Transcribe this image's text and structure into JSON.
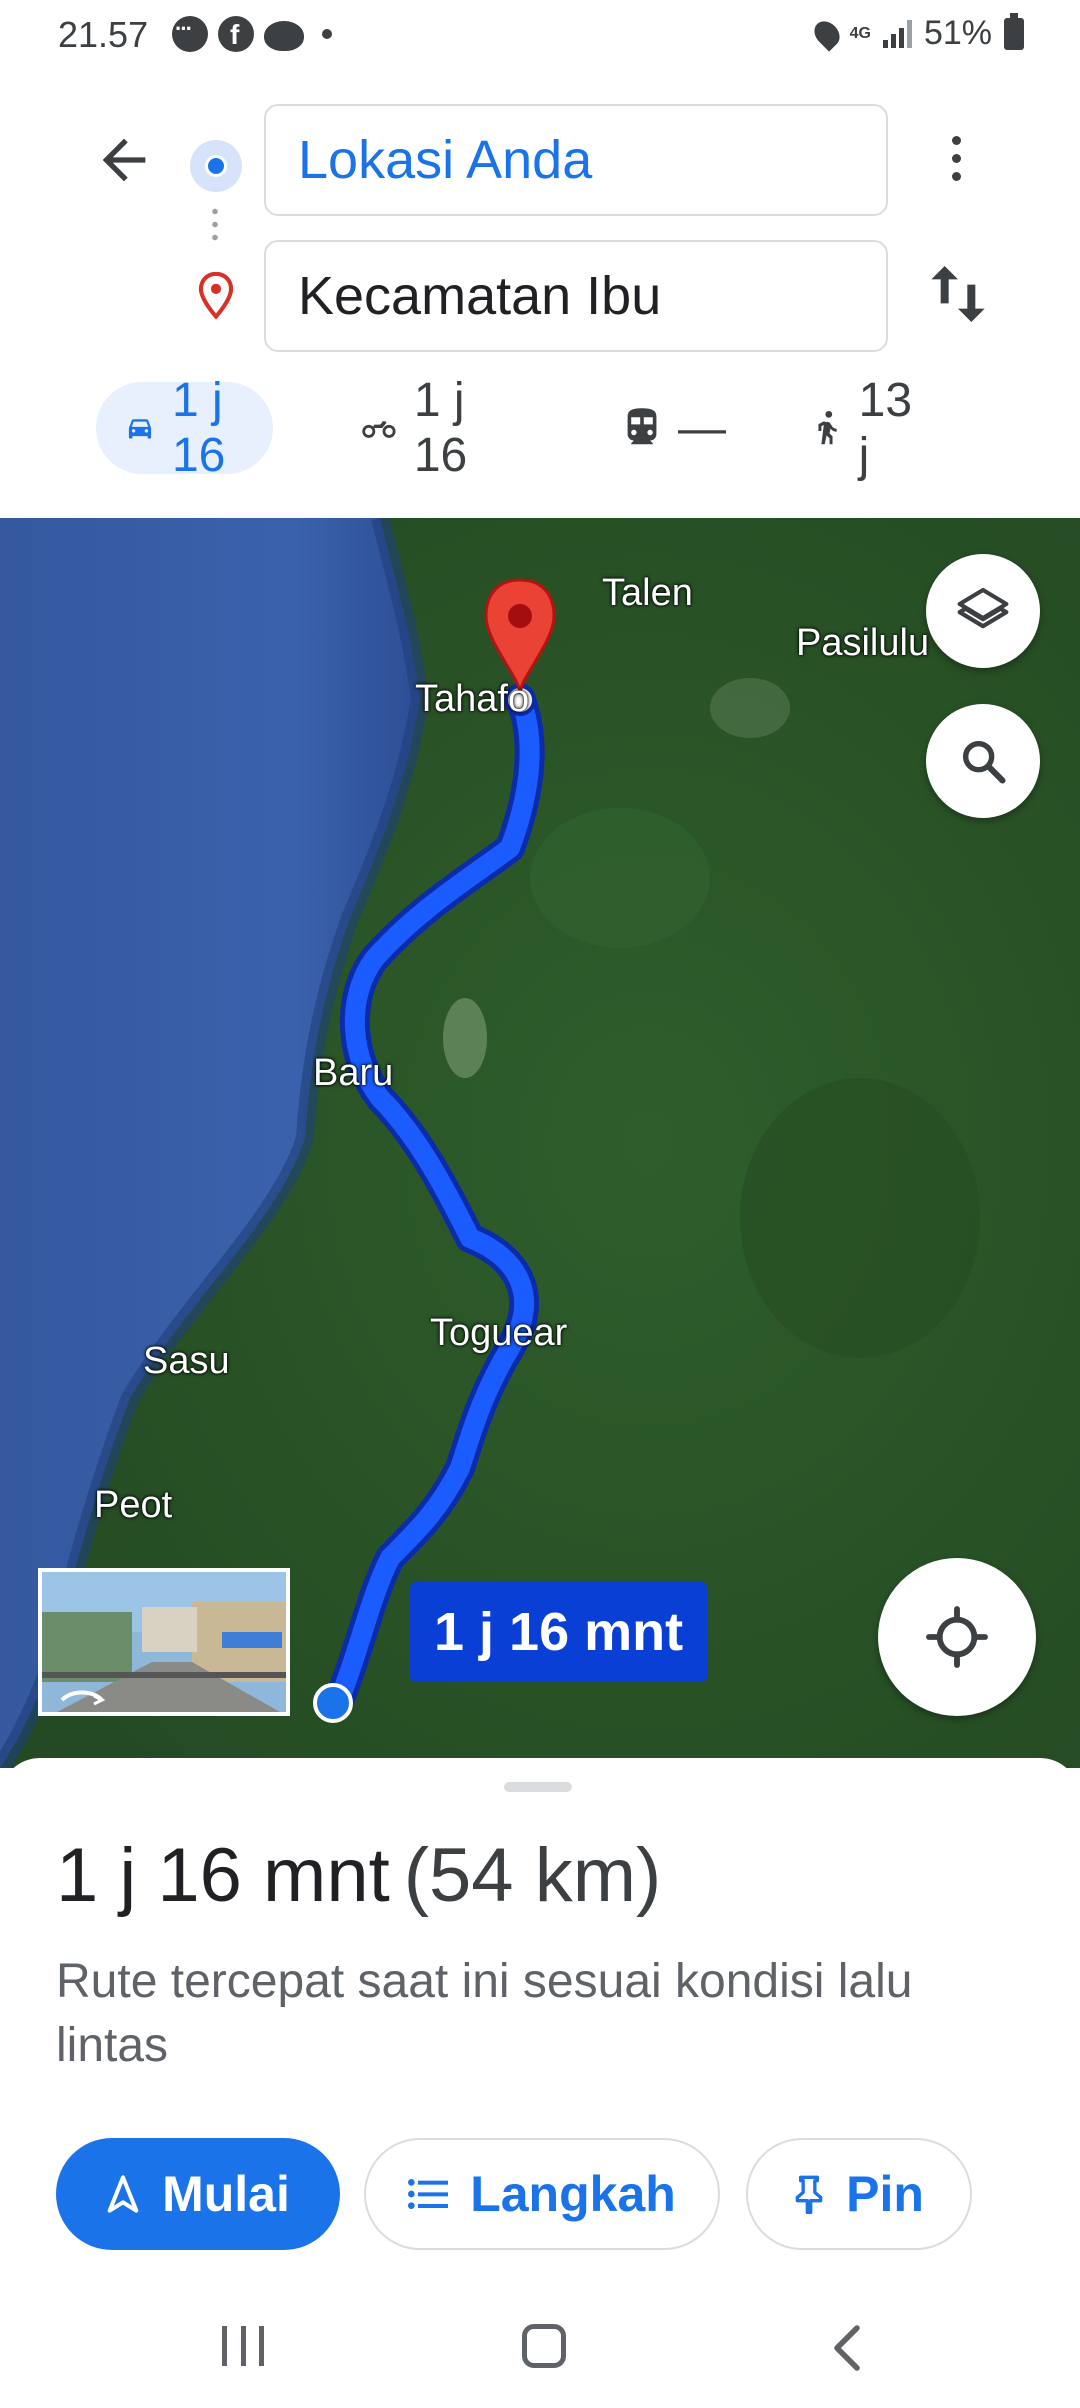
{
  "status_bar": {
    "time": "21.57",
    "network": "4G",
    "battery": "51%",
    "icons": [
      "chat-icon",
      "facebook-icon",
      "planet-icon",
      "notification-dot",
      "location-icon",
      "signal-icon",
      "battery-icon"
    ]
  },
  "directions": {
    "origin_value": "Lokasi Anda",
    "destination_value": "Kecamatan Ibu"
  },
  "modes": [
    {
      "id": "car",
      "icon": "car-icon",
      "label": "1 j 16",
      "selected": true
    },
    {
      "id": "motorcycle",
      "icon": "motorcycle-icon",
      "label": "1 j 16",
      "selected": false
    },
    {
      "id": "transit",
      "icon": "train-icon",
      "label": "—",
      "selected": false
    },
    {
      "id": "walk",
      "icon": "walk-icon",
      "label": "13 j",
      "selected": false
    }
  ],
  "map": {
    "places": [
      "Talen",
      "Pasilulu",
      "Tahafo",
      "Baru",
      "Toguear",
      "Sasu",
      "Peot"
    ],
    "route_label": "1 j 16 mnt",
    "colors": {
      "route": "#1a5cff",
      "route_label_bg": "#0a3fd6",
      "pin": "#d93025",
      "water": "#2c4f98",
      "land": "#2d5a2a"
    }
  },
  "summary": {
    "duration": "1 j 16 mnt",
    "distance": "(54 km)",
    "description": "Rute tercepat saat ini sesuai kondisi lalu lintas"
  },
  "actions": {
    "start_label": "Mulai",
    "steps_label": "Langkah",
    "pin_label": "Pin"
  },
  "colors": {
    "accent": "#1a73e8",
    "chip_bg": "#e8f0fe"
  }
}
